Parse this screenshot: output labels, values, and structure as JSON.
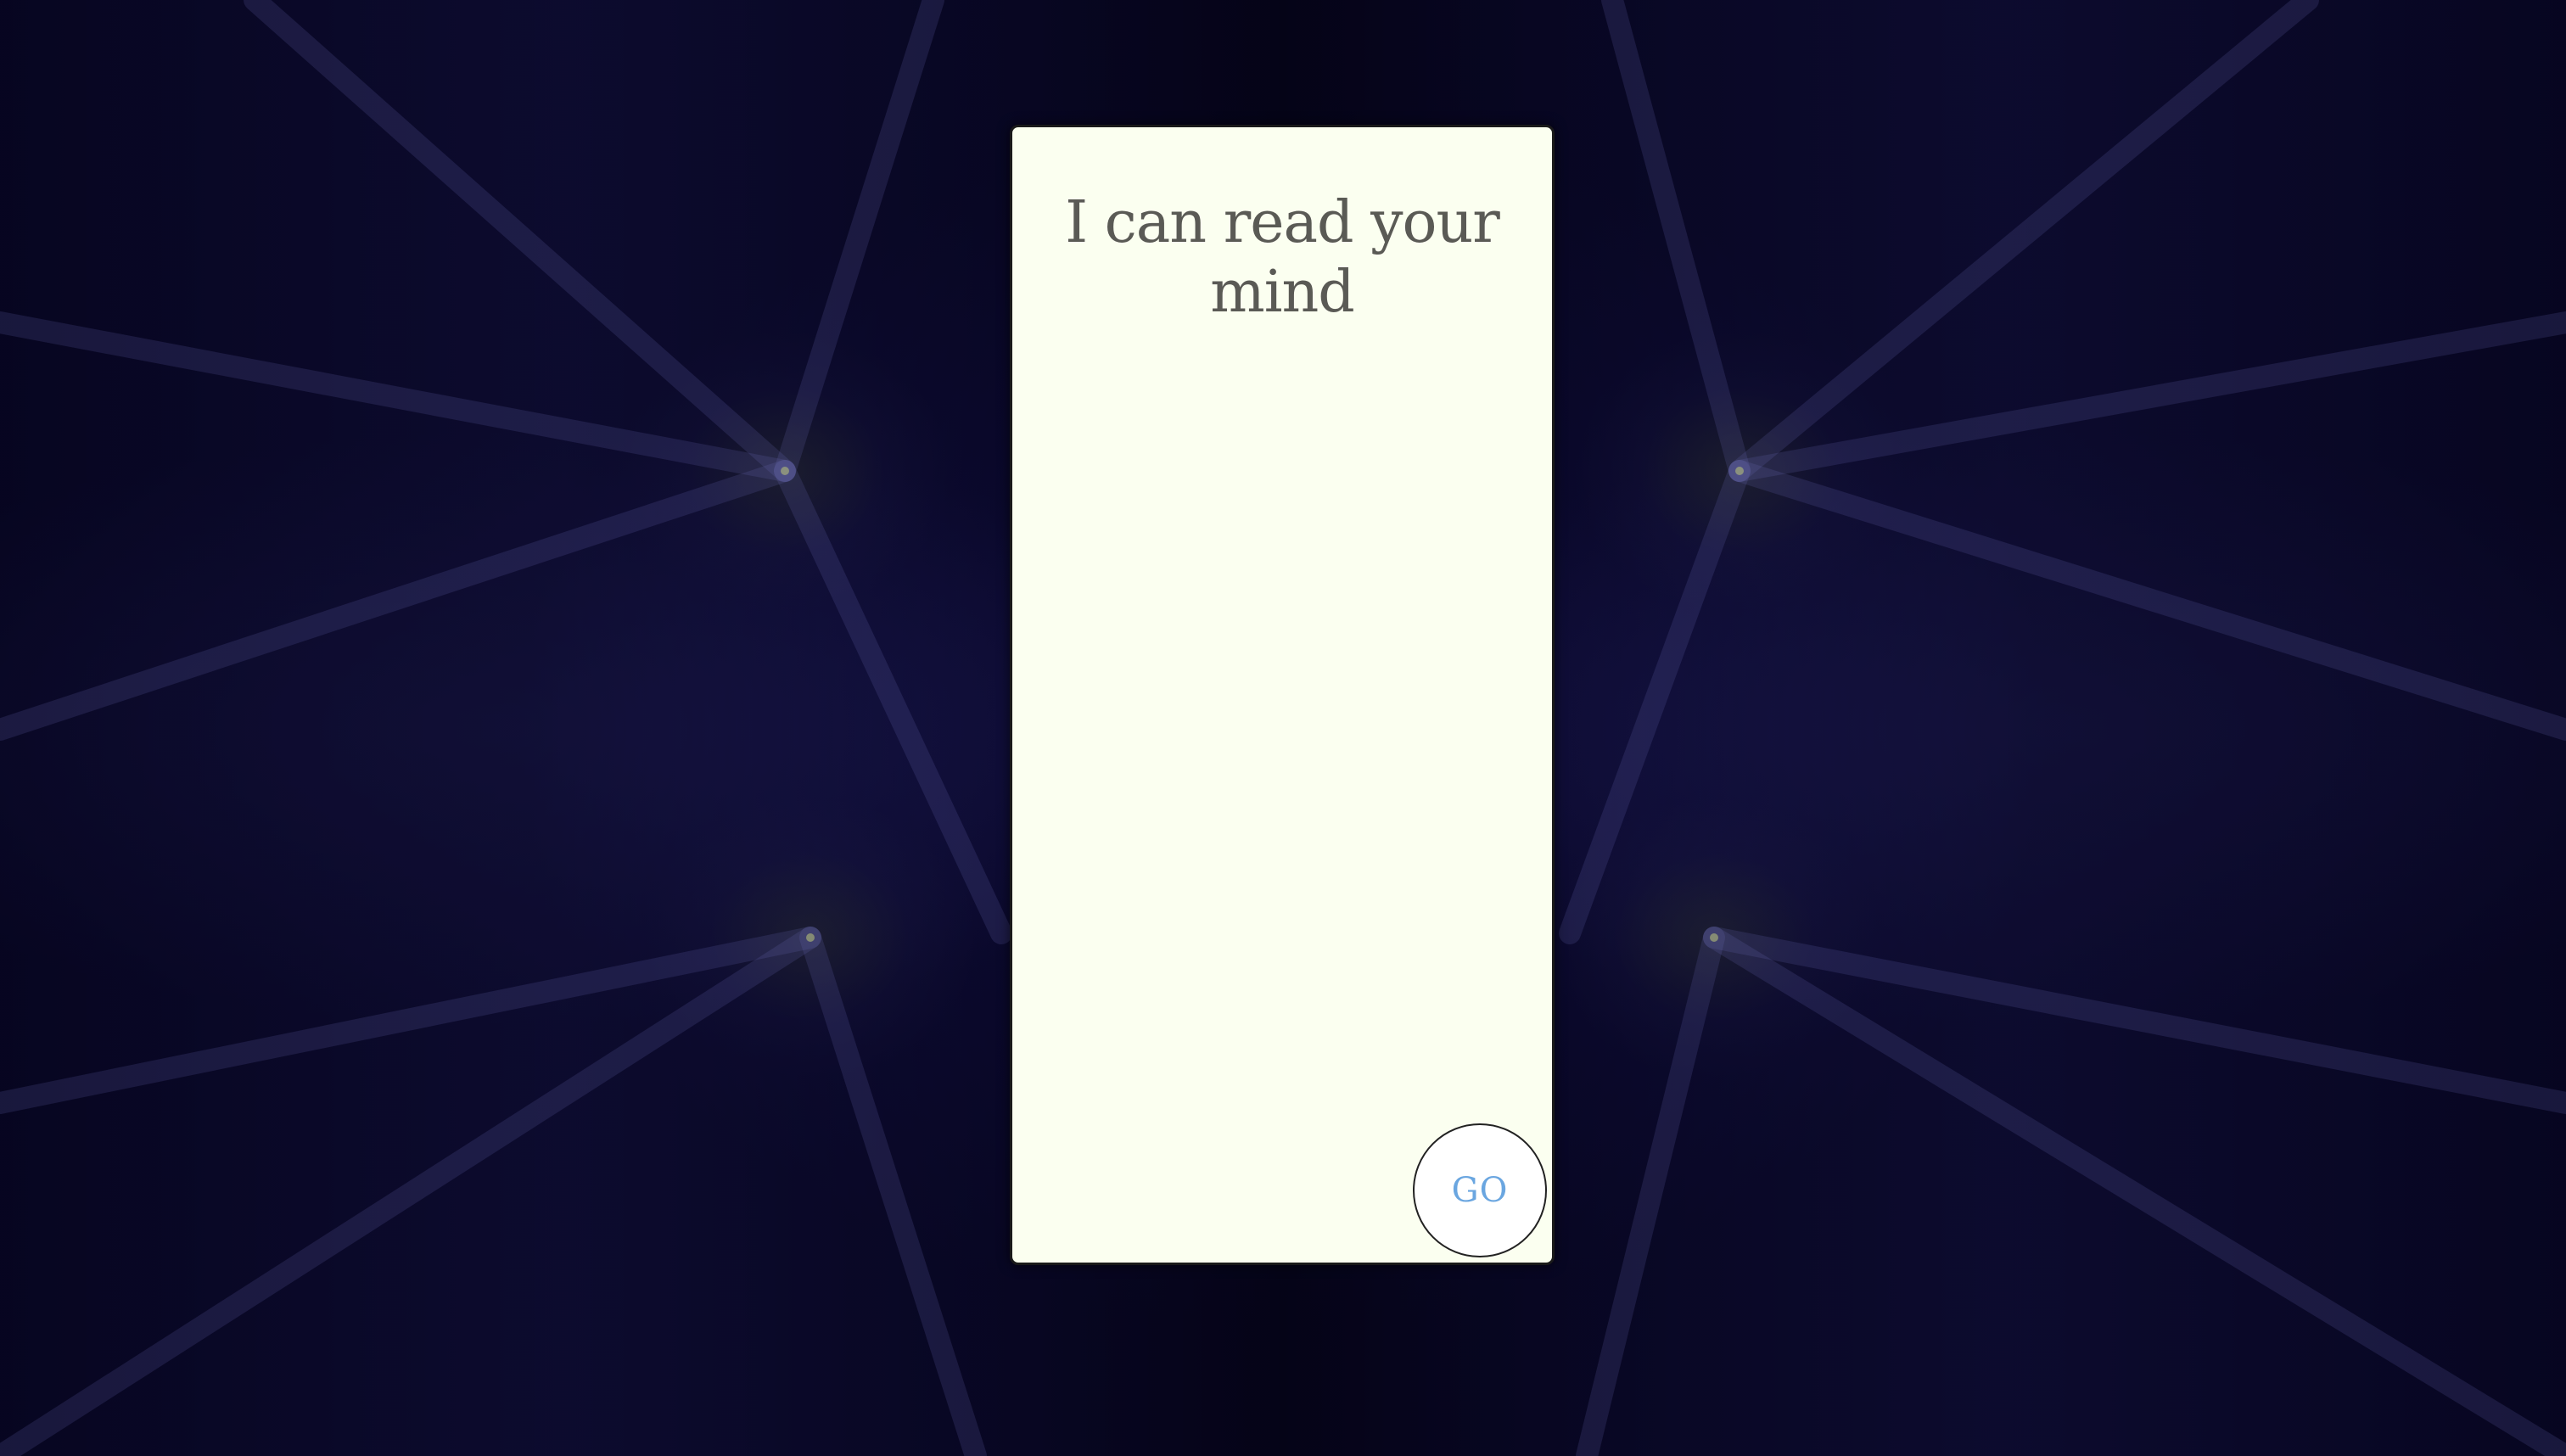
{
  "page": {
    "title": "I can read your mind",
    "go_label": "GO"
  },
  "colors": {
    "background": "#0b0930",
    "card": "#fbfff0",
    "title_text": "#5a5a55",
    "button_text": "#6aa6e0"
  }
}
